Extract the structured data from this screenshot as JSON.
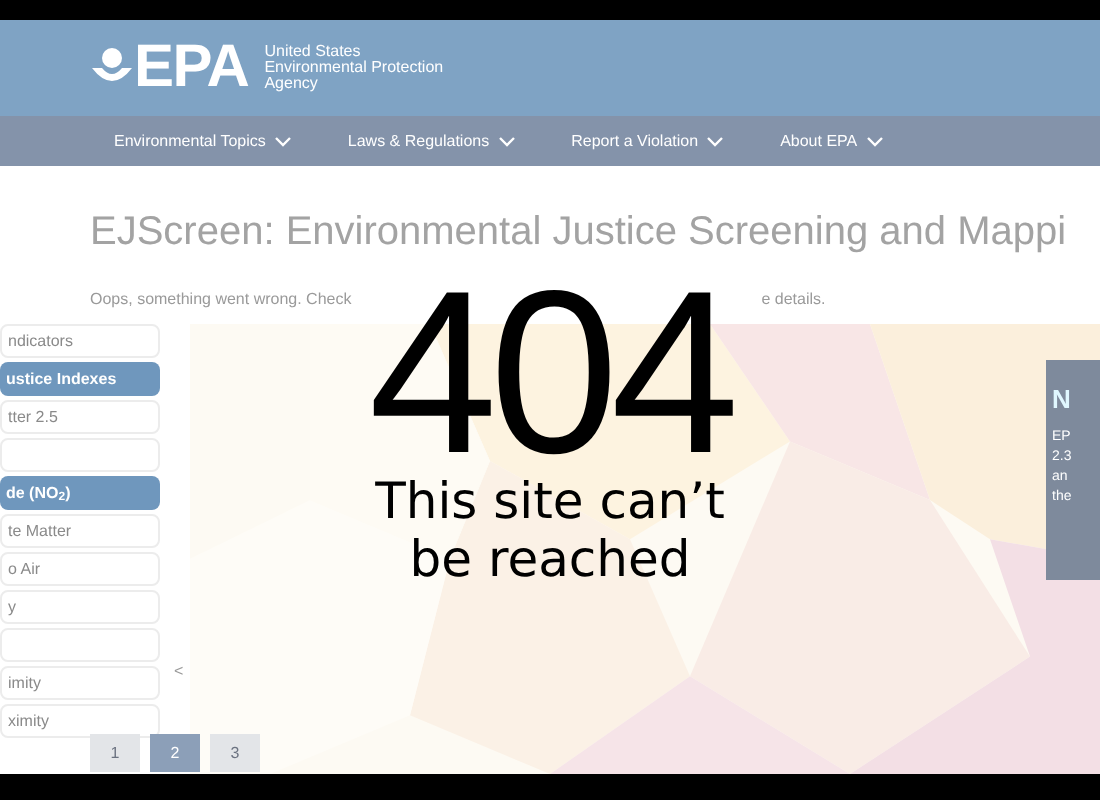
{
  "header": {
    "logo_text": "EPA",
    "agency": [
      "United States",
      "Environmental Protection",
      "Agency"
    ]
  },
  "nav": [
    {
      "label": "Environmental Topics"
    },
    {
      "label": "Laws & Regulations"
    },
    {
      "label": "Report a Violation"
    },
    {
      "label": "About EPA"
    }
  ],
  "page": {
    "title": "EJScreen: Environmental Justice Screening and Mappi",
    "message": [
      "Oops, something went wrong. Check",
      "e details."
    ]
  },
  "sidebar": {
    "items": [
      {
        "label": "ndicators",
        "selected": false
      },
      {
        "label": "ustice Indexes",
        "selected": true
      },
      {
        "label": "tter 2.5",
        "selected": false
      },
      {
        "selected": false
      },
      {
        "label": "de (NO$_{2}$)",
        "selected": true
      },
      {
        "label": "te Matter",
        "selected": false
      },
      {
        "label": "o Air",
        "selected": false
      },
      {
        "label": "y",
        "selected": false
      },
      {
        "selected": false
      },
      {
        "label": "imity",
        "selected": false
      },
      {
        "label": "ximity",
        "selected": false
      }
    ]
  },
  "collapse": "<",
  "pager": [
    {
      "label": "1",
      "selected": false
    },
    {
      "label": "2",
      "selected": true
    },
    {
      "label": "3",
      "selected": false
    }
  ],
  "notice": {
    "title": "N",
    "lines": [
      "EP",
      "2.3",
      "an",
      "the"
    ]
  },
  "error": {
    "code": "404",
    "message": "This site can’t be reached"
  }
}
